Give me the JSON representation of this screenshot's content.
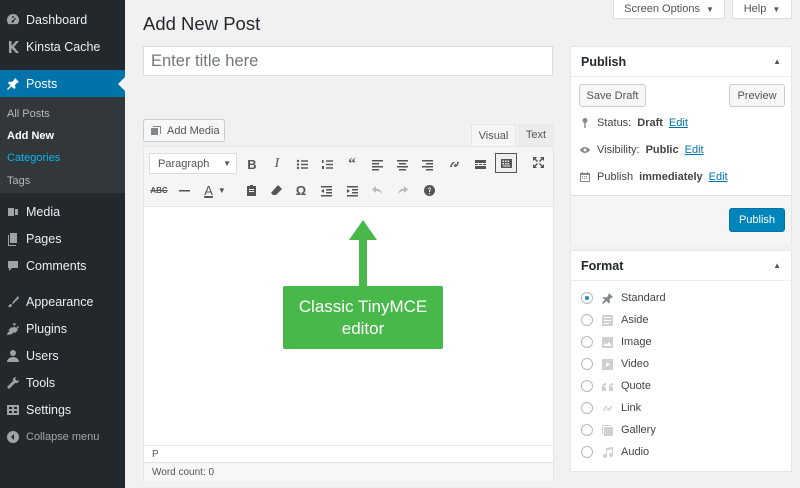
{
  "sidebar": {
    "items": [
      {
        "label": "Dashboard",
        "icon": "dashboard-icon"
      },
      {
        "label": "Kinsta Cache",
        "icon": "kinsta-icon"
      },
      {
        "label": "Posts",
        "icon": "pin-icon"
      },
      {
        "label": "Media",
        "icon": "media-icon"
      },
      {
        "label": "Pages",
        "icon": "pages-icon"
      },
      {
        "label": "Comments",
        "icon": "comments-icon"
      },
      {
        "label": "Appearance",
        "icon": "appearance-icon"
      },
      {
        "label": "Plugins",
        "icon": "plugins-icon"
      },
      {
        "label": "Users",
        "icon": "users-icon"
      },
      {
        "label": "Tools",
        "icon": "tools-icon"
      },
      {
        "label": "Settings",
        "icon": "settings-icon"
      }
    ],
    "submenu": [
      "All Posts",
      "Add New",
      "Categories",
      "Tags"
    ],
    "collapse_label": "Collapse menu"
  },
  "top": {
    "screen_options": "Screen Options",
    "help": "Help"
  },
  "page": {
    "title": "Add New Post",
    "title_placeholder": "Enter title here"
  },
  "editor": {
    "add_media": "Add Media",
    "tab_visual": "Visual",
    "tab_text": "Text",
    "format_select": "Paragraph",
    "path": "P",
    "word_count": "Word count: 0"
  },
  "annotation": {
    "text": "Classic TinyMCE editor",
    "color": "#48b84b"
  },
  "publish": {
    "title": "Publish",
    "save_draft": "Save Draft",
    "preview": "Preview",
    "status_label": "Status:",
    "status_value": "Draft",
    "visibility_label": "Visibility:",
    "visibility_value": "Public",
    "publish_label": "Publish",
    "publish_value": "immediately",
    "edit": "Edit",
    "publish_button": "Publish"
  },
  "format": {
    "title": "Format",
    "options": [
      "Standard",
      "Aside",
      "Image",
      "Video",
      "Quote",
      "Link",
      "Gallery",
      "Audio"
    ],
    "selected": "Standard"
  },
  "colors": {
    "sidebar": "#23282d",
    "accent": "#0073aa",
    "primary_button": "#0085ba"
  }
}
